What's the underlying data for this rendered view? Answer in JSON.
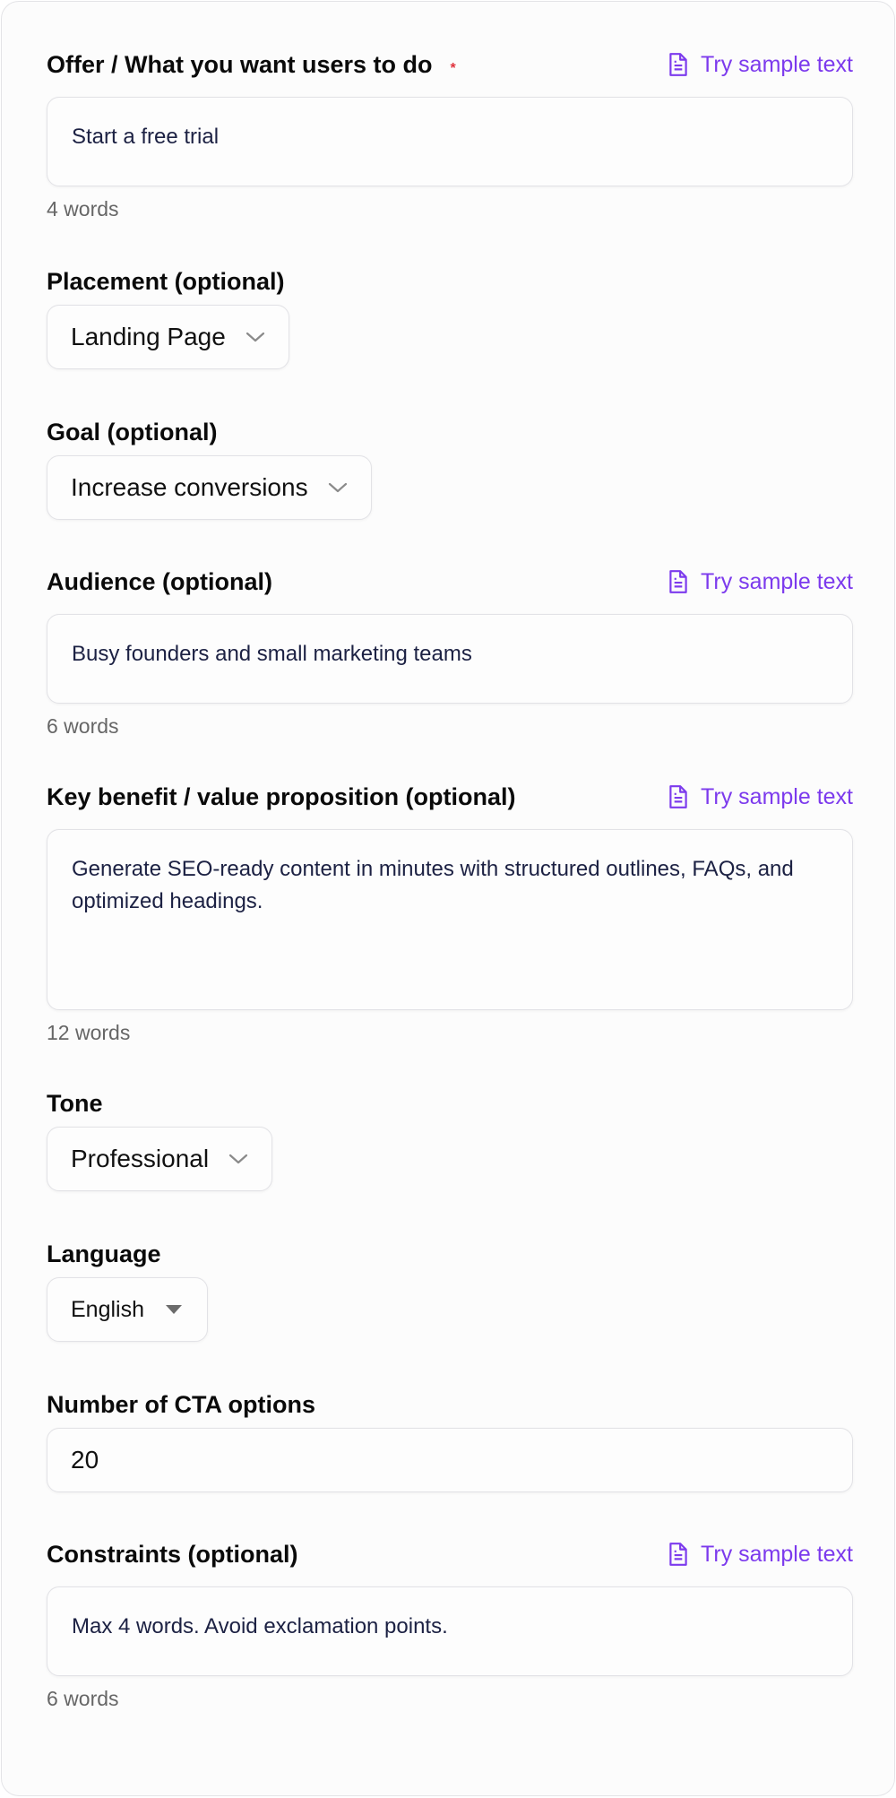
{
  "sample_label": "Try sample text",
  "offer": {
    "label": "Offer / What you want users to do",
    "required_mark": "*",
    "value": "Start a free trial",
    "count": "4 words"
  },
  "placement": {
    "label": "Placement (optional)",
    "value": "Landing Page"
  },
  "goal": {
    "label": "Goal (optional)",
    "value": "Increase conversions"
  },
  "audience": {
    "label": "Audience (optional)",
    "value": "Busy founders and small marketing teams",
    "count": "6 words"
  },
  "benefit": {
    "label": "Key benefit / value proposition (optional)",
    "value": "Generate SEO-ready content in minutes with structured outlines, FAQs, and optimized headings.",
    "count": "12 words"
  },
  "tone": {
    "label": "Tone",
    "value": "Professional"
  },
  "language": {
    "label": "Language",
    "value": "English"
  },
  "cta_count": {
    "label": "Number of CTA options",
    "value": "20"
  },
  "constraints": {
    "label": "Constraints (optional)",
    "value": "Max 4 words. Avoid exclamation points.",
    "count": "6 words"
  },
  "colors": {
    "accent": "#7c3aed",
    "required": "#e0323c",
    "text_value": "#1c2143"
  }
}
